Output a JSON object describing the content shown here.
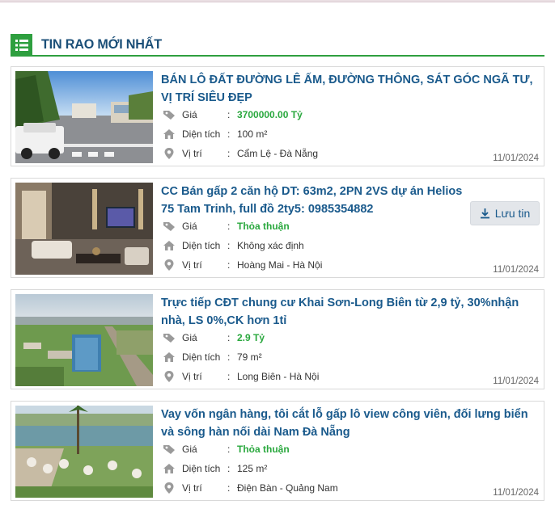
{
  "section": {
    "title": "TIN RAO MỚI NHẤT",
    "icon": "list-icon"
  },
  "labels": {
    "price": "Giá",
    "area": "Diện tích",
    "location": "Vị trí",
    "colon": ":"
  },
  "save_label": "Lưu tin",
  "listings": [
    {
      "title": "BÁN LÔ ĐẤT ĐƯỜNG LÊ ẤM, ĐƯỜNG THÔNG, SÁT GÓC NGÃ TƯ, VỊ TRÍ SIÊU ĐẸP",
      "price": "3700000.00 Tỷ",
      "area": "100 m²",
      "location": "Cẩm Lệ - Đà Nẵng",
      "date": "11/01/2024"
    },
    {
      "title": "CC Bán gấp 2 căn hộ DT: 63m2, 2PN 2VS dự án Helios 75 Tam Trinh, full đồ 2ty5: 0985354882",
      "price": "Thỏa thuận",
      "area": "Không xác định",
      "location": "Hoàng Mai - Hà Nội",
      "date": "11/01/2024"
    },
    {
      "title": "Trực tiếp CĐT chung cư Khai Sơn-Long Biên từ 2,9 tỷ, 30%nhận nhà, LS 0%,CK hơn 1tỉ",
      "price": "2.9 Tỷ",
      "area": "79 m²",
      "location": "Long Biên - Hà Nội",
      "date": "11/01/2024"
    },
    {
      "title": "Vay vốn ngân hàng, tôi cắt lỗ gấp lô view công viên, đối lưng biển và sông hàn nối dài Nam Đà Nẵng",
      "price": "Thỏa thuận",
      "area": "125 m²",
      "location": "Điện Bàn - Quảng Nam",
      "date": "11/01/2024"
    }
  ],
  "colors": {
    "accent_green": "#2e9f3f",
    "title_blue": "#1a5a8c",
    "price_green": "#2aa83e"
  }
}
